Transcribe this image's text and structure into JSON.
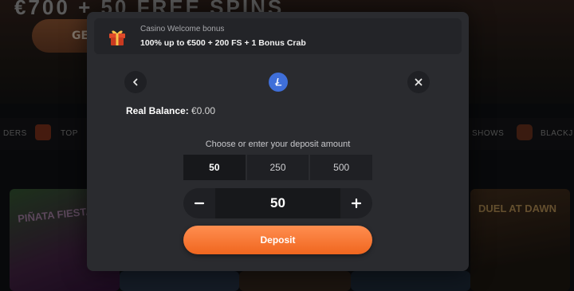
{
  "background": {
    "nav_items": [
      "DERS",
      "TOP",
      "SHOWS",
      "BLACKJ"
    ],
    "get_button_label": "GE",
    "headline": "€700 + 50 FREE SPINS",
    "tile_labels": [
      "PIÑATA FIESTA",
      "DUEL AT DAWN"
    ]
  },
  "promo": {
    "title": "Casino Welcome bonus",
    "subtitle": "100% up to €500 + 200 FS + 1 Bonus Crab",
    "icon": "gift-icon"
  },
  "header": {
    "back_icon": "chevron-left-icon",
    "currency_icon": "litecoin-icon",
    "close_icon": "close-icon"
  },
  "balance": {
    "label": "Real Balance:",
    "value": "€0.00"
  },
  "deposit": {
    "prompt": "Choose or enter your deposit amount",
    "presets": [
      "50",
      "250",
      "500"
    ],
    "selected_preset": "50",
    "amount": "50",
    "button_label": "Deposit"
  },
  "colors": {
    "accent": "#f0661f",
    "modal_bg": "#2a2b2f",
    "litecoin": "#3f6fd9"
  }
}
